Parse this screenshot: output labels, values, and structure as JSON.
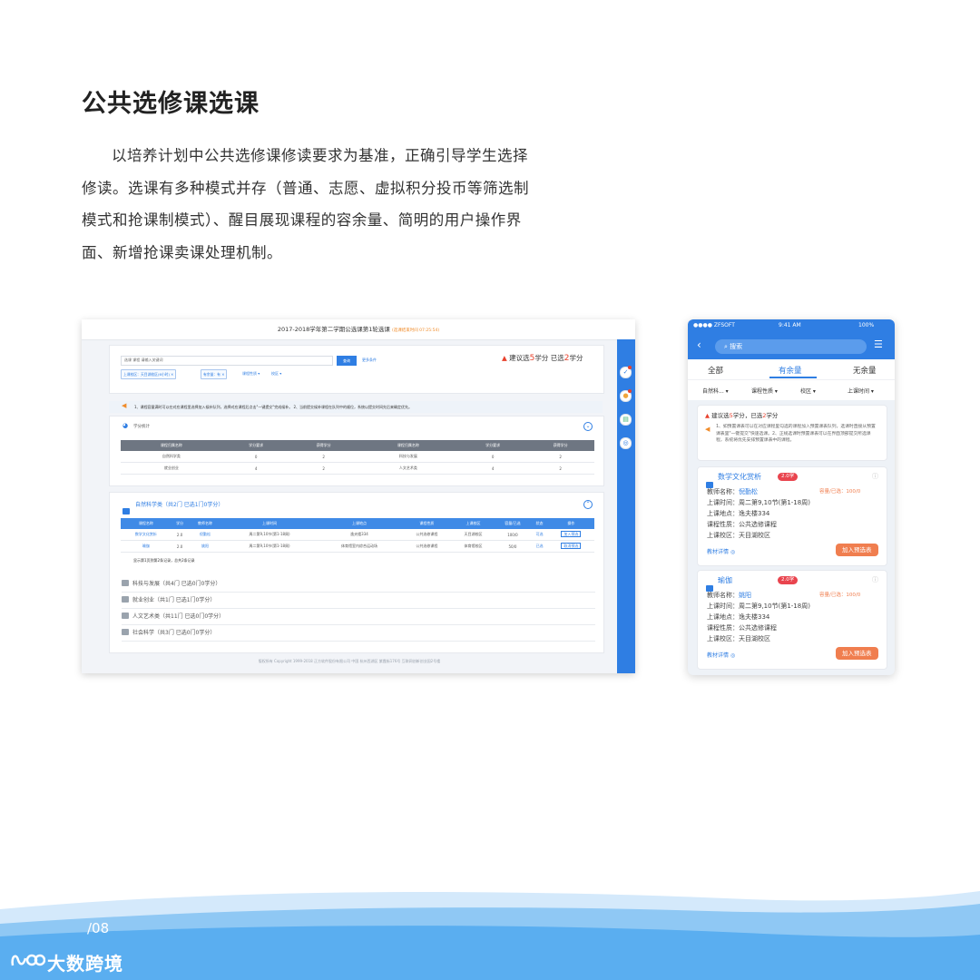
{
  "page": {
    "title": "公共选修课选课",
    "intro": "以培养计划中公共选修课修读要求为基准，正确引导学生选择修读。选课有多种模式并存（普通、志愿、虚拟积分投币等筛选制模式和抢课制模式）、醒目展现课程的容余量、简明的用户操作界面、新增抢课卖课处理机制。",
    "page_number": "/08",
    "brand": "大数跨境"
  },
  "desktop": {
    "header_title": "2017-2018学年第二学期公选课第1轮选课",
    "header_note": "(选课结束时间 07:25:54)",
    "search_prefix": "选课 课程 请输入关键词",
    "search_button": "查询",
    "search_link": "更多条件",
    "filter_chips": [
      "上课校区：天目湖校区(6小时)",
      "有余量：有"
    ],
    "filter_links": [
      "课程性质",
      "校区"
    ],
    "credit_summary": {
      "suggest_prefix": "建议选",
      "suggest_value": "5",
      "mid": "学分  已选",
      "selected_value": "2",
      "suffix": "学分"
    },
    "notice": "1、课程容量满时可以在对应课程里选择加入候补队列，选择对应课程后点击\"一键提交\"完成候补。   2、当前提交候补课程在队列中的顺位，系统以提交时间先后来确定优先。",
    "credit_section": {
      "title": "学分统计",
      "headers": [
        "课程归属名称",
        "学分要求",
        "获得学分",
        "课程归属名称",
        "学分要求",
        "获得学分"
      ],
      "rows": [
        [
          "自然科学类",
          "0",
          "2",
          "科技与发展",
          "0",
          "2"
        ],
        [
          "就业创业",
          "4",
          "2",
          "人文艺术类",
          "4",
          "2"
        ]
      ]
    },
    "course_section": {
      "title": "自然科学类（共2门 已选1门0学分）",
      "headers": [
        "课程名称",
        "学分",
        "教师名称",
        "上课时间",
        "上课地点",
        "课程性质",
        "上课校区",
        "容量/已选",
        "状态",
        "操作"
      ],
      "rows": [
        [
          "数学文化赏析",
          "2.0",
          "倪勤松",
          "周二第9,10节(第1-18周)",
          "逸夫楼334",
          "公共选修课程",
          "天目湖校区",
          "100/0",
          "可选",
          "加入预选"
        ],
        [
          "瑜伽",
          "2.0",
          "姚阳",
          "周二第9,10节(第1-18周)",
          "体育馆室内综合运动场",
          "公共选修课程",
          "体育馆校区",
          "50/0",
          "已选",
          "取消预选"
        ]
      ],
      "footer": "显示第1页到第2条记录，总共2条记录"
    },
    "other_categories": [
      "科技与发展（共4门 已选0门0学分）",
      "就业创业（共1门 已选1门0学分）",
      "人文艺术类（共11门 已选0门0学分）",
      "社会科学（共3门 已选0门0学分）"
    ],
    "footer_text": "版权所有 Copyright 1999-2018 正方软件股份有限公司    中国 杭州西湖区 紫霞街176号 互联网创新创业园2号楼"
  },
  "phone": {
    "carrier": "ZFSOFT",
    "time": "9:41 AM",
    "battery": "100%",
    "search_placeholder": "搜索",
    "tabs": [
      "全部",
      "有余量",
      "无余量"
    ],
    "filters": [
      "自然科...",
      "课程性质",
      "校区",
      "上课时间"
    ],
    "credit": {
      "prefix": "建议选",
      "suggest": "5",
      "mid": "学分，已选",
      "selected": "2",
      "suffix": "学分"
    },
    "notice": "1、如预置课表可以在对应课程里勾选的课程加入预置课表队列，选课时直接从预置课表里\"一键提交\"快速选课。2、正规选课时预置课表可以在界面顶部提交所选课程，系统将优先安排预置课表中的课程。",
    "cards": [
      {
        "name": "数学文化赏析",
        "credit": "2.0学",
        "teacher_label": "教师名称：",
        "teacher": "倪勤松",
        "capacity": "容量/已选：100/0",
        "time": "上课时间：周二第9,10节(第1-18周)",
        "place": "上课地点：逸夫楼334",
        "nature": "课程性质：公共选修课程",
        "campus": "上课校区：天目湖校区",
        "detail": "教材详情",
        "action": "加入预选表"
      },
      {
        "name": "瑜伽",
        "credit": "2.0学",
        "teacher_label": "教师名称：",
        "teacher": "姚阳",
        "capacity": "容量/已选：100/0",
        "time": "上课时间：周二第9,10节(第1-18周)",
        "place": "上课地点：逸夫楼334",
        "nature": "课程性质：公共选修课程",
        "campus": "上课校区：天目湖校区",
        "detail": "教材详情",
        "action": "加入预选表"
      }
    ]
  },
  "colors": {
    "accent": "#2f7ee3",
    "warning": "#e8412c",
    "orange": "#f07e4f",
    "wave_light": "#cfe6fb",
    "wave_dark": "#5fb0f0"
  }
}
